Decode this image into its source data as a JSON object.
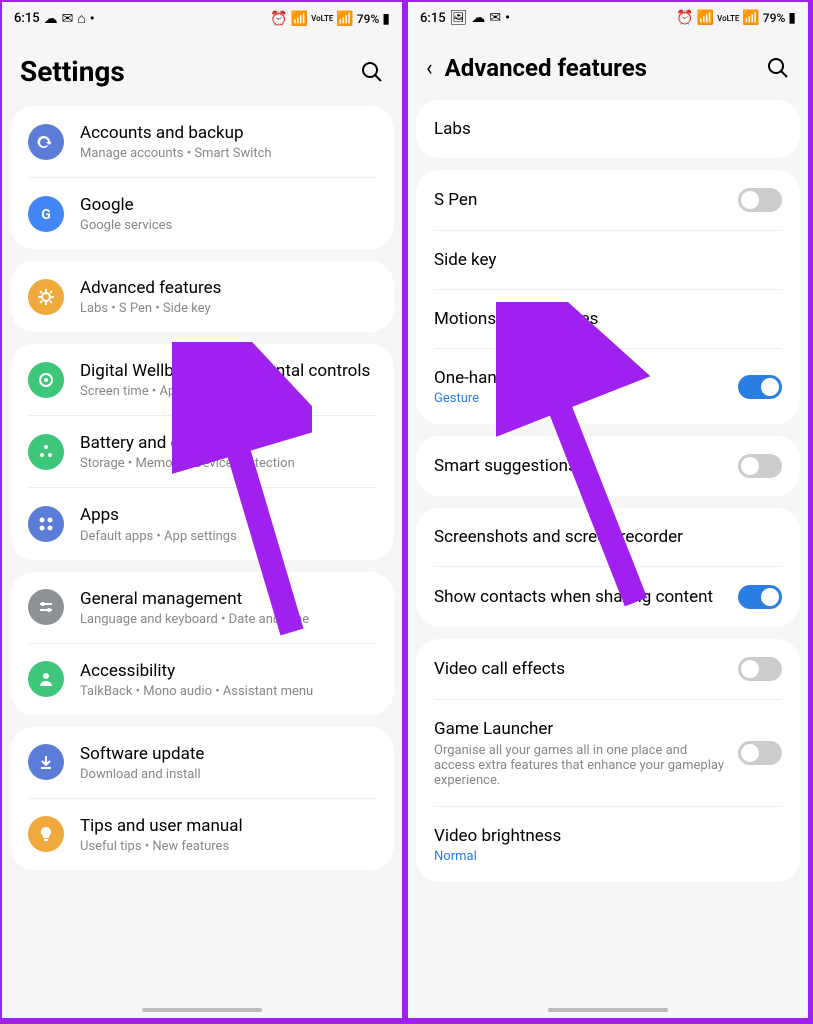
{
  "status": {
    "time": "6:15",
    "battery": "79%"
  },
  "left": {
    "title": "Settings",
    "groups": [
      {
        "items": [
          {
            "title": "Accounts and backup",
            "sub": "Manage accounts  •  Smart Switch",
            "iconBg": "#5b7dd8",
            "iconGlyph": "sync"
          },
          {
            "title": "Google",
            "sub": "Google services",
            "iconBg": "#4285f4",
            "iconGlyph": "g"
          }
        ]
      },
      {
        "items": [
          {
            "title": "Advanced features",
            "sub": "Labs  •  S Pen  •  Side key",
            "iconBg": "#f0a93c",
            "iconGlyph": "gear"
          }
        ]
      },
      {
        "items": [
          {
            "title": "Digital Wellbeing and parental controls",
            "sub": "Screen time  •  App timers",
            "iconBg": "#3ec77a",
            "iconGlyph": "circle"
          },
          {
            "title": "Battery and device care",
            "sub": "Storage  •  Memory  •  Device protection",
            "iconBg": "#3ec77a",
            "iconGlyph": "dots3"
          },
          {
            "title": "Apps",
            "sub": "Default apps  •  App settings",
            "iconBg": "#5b7dd8",
            "iconGlyph": "dots4"
          }
        ]
      },
      {
        "items": [
          {
            "title": "General management",
            "sub": "Language and keyboard  •  Date and time",
            "iconBg": "#8c9196",
            "iconGlyph": "sliders"
          },
          {
            "title": "Accessibility",
            "sub": "TalkBack  •  Mono audio  •  Assistant menu",
            "iconBg": "#3ec77a",
            "iconGlyph": "person"
          }
        ]
      },
      {
        "items": [
          {
            "title": "Software update",
            "sub": "Download and install",
            "iconBg": "#5b7dd8",
            "iconGlyph": "download"
          },
          {
            "title": "Tips and user manual",
            "sub": "Useful tips  •  New features",
            "iconBg": "#f0a93c",
            "iconGlyph": "bulb"
          }
        ]
      }
    ]
  },
  "right": {
    "title": "Advanced features",
    "groups": [
      {
        "items": [
          {
            "title": "Labs"
          }
        ]
      },
      {
        "items": [
          {
            "title": "S Pen",
            "toggle": "off"
          },
          {
            "title": "Side key"
          },
          {
            "title": "Motions and gestures"
          },
          {
            "title": "One-handed mode",
            "sub": "Gesture",
            "subBlue": true,
            "toggle": "on"
          }
        ]
      },
      {
        "items": [
          {
            "title": "Smart suggestions",
            "toggle": "off"
          }
        ]
      },
      {
        "items": [
          {
            "title": "Screenshots and screen recorder"
          },
          {
            "title": "Show contacts when sharing content",
            "toggle": "on"
          }
        ]
      },
      {
        "items": [
          {
            "title": "Video call effects",
            "toggle": "off"
          },
          {
            "title": "Game Launcher",
            "sub": "Organise all your games all in one place and access extra features that enhance your gameplay experience.",
            "toggle": "off"
          },
          {
            "title": "Video brightness",
            "sub": "Normal",
            "subBlue": true
          }
        ]
      }
    ]
  }
}
